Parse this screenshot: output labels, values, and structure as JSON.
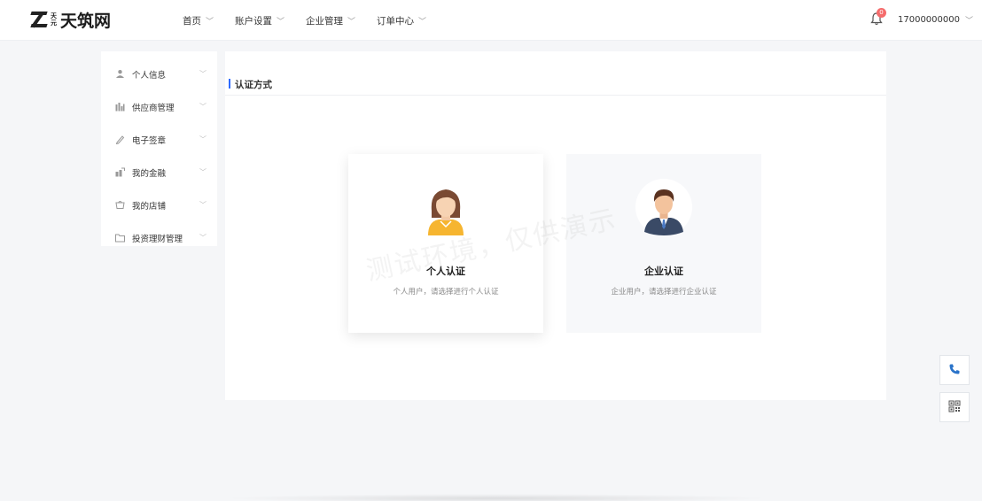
{
  "brand": {
    "small_text": "天元",
    "name": "天筑网"
  },
  "nav": [
    {
      "label": "首页"
    },
    {
      "label": "账户设置"
    },
    {
      "label": "企业管理"
    },
    {
      "label": "订单中心"
    }
  ],
  "notifications": {
    "count": "0"
  },
  "user": {
    "phone": "17000000000"
  },
  "sidebar": {
    "items": [
      {
        "label": "个人信息",
        "icon": "user-icon"
      },
      {
        "label": "供应商管理",
        "icon": "bar-chart-icon"
      },
      {
        "label": "电子签章",
        "icon": "pen-icon"
      },
      {
        "label": "我的金融",
        "icon": "finance-icon"
      },
      {
        "label": "我的店铺",
        "icon": "shop-icon"
      },
      {
        "label": "投资理财管理",
        "icon": "folder-icon"
      }
    ]
  },
  "main": {
    "section_title": "认证方式",
    "watermark": "测试环境，仅供演示",
    "cards": [
      {
        "title": "个人认证",
        "desc": "个人用户，请选择进行个人认证",
        "icon": "female-avatar-icon"
      },
      {
        "title": "企业认证",
        "desc": "企业用户，请选择进行企业认证",
        "icon": "male-businessman-avatar-icon"
      }
    ]
  },
  "colors": {
    "accent": "#2f6bff",
    "badge": "#f56c6c",
    "avatar_female": "#f6b530",
    "avatar_male_suit": "#3a4a66"
  }
}
